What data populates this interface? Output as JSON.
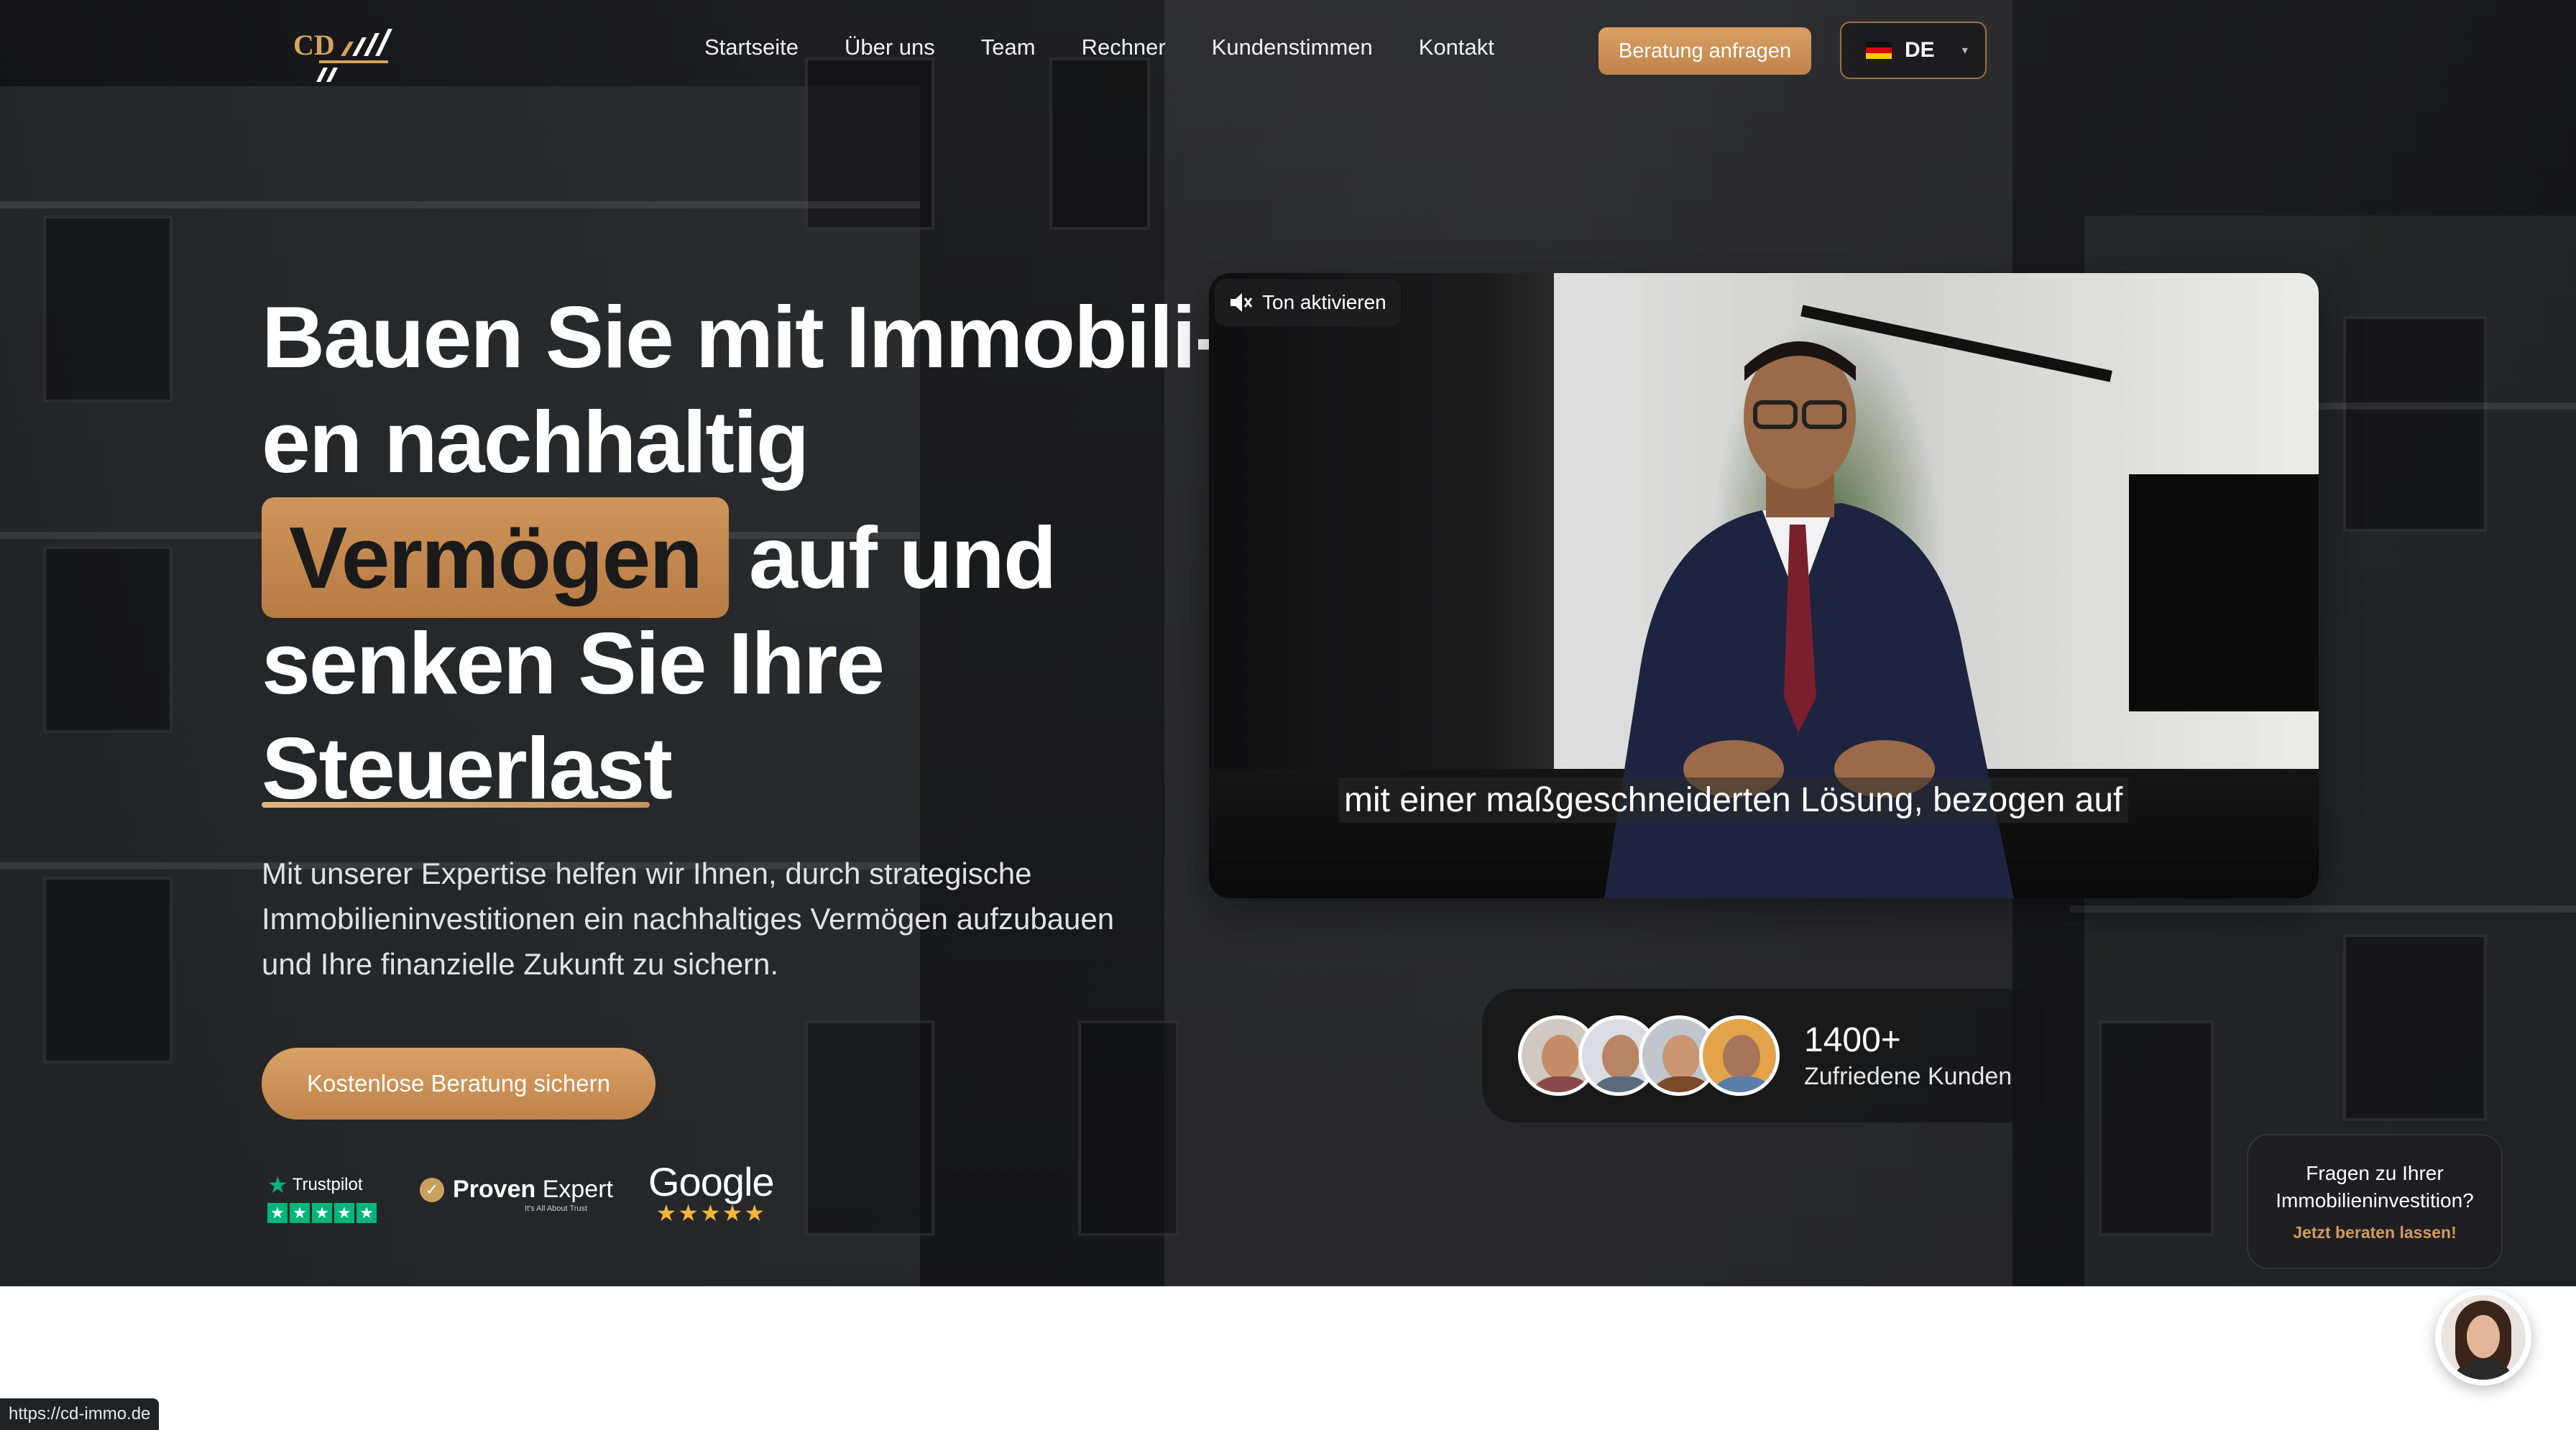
{
  "nav": {
    "items": [
      "Startseite",
      "Über uns",
      "Team",
      "Rechner",
      "Kundenstimmen",
      "Kontakt"
    ],
    "cta_label": "Beratung anfragen",
    "language": "DE"
  },
  "hero": {
    "headline": {
      "line1": "Bauen Sie mit Immobili-",
      "line2": "en nachhaltig",
      "highlight": "Vermögen",
      "line3_rest": "auf und",
      "line4": "senken Sie Ihre",
      "line5": "Steuerlast"
    },
    "lead": "Mit unserer Expertise helfen wir Ihnen, durch strategische Immobilieninvestitionen ein nachhaltiges Vermögen aufzubauen und Ihre finanzielle Zukunft zu sichern.",
    "cta_label": "Kostenlose Beratung sichern"
  },
  "badges": {
    "trustpilot": "Trustpilot",
    "provenexpert_bold": "Proven",
    "provenexpert_rest": "Expert",
    "provenexpert_tag": "It's All About Trust",
    "google": "Google"
  },
  "video": {
    "mute_label": "Ton aktivieren",
    "subtitle": "mit einer maßgeschneiderten Lösung, bezogen auf"
  },
  "customers": {
    "count": "1400+",
    "label": "Zufriedene Kunden"
  },
  "chat": {
    "question": "Fragen zu Ihrer Immobilieninvestition?",
    "link": "Jetzt beraten lassen!"
  },
  "status_url": "https://cd-immo.de",
  "colors": {
    "accent": "#c98d52",
    "trustpilot_green": "#00b67a",
    "google_star": "#f3b63d"
  }
}
